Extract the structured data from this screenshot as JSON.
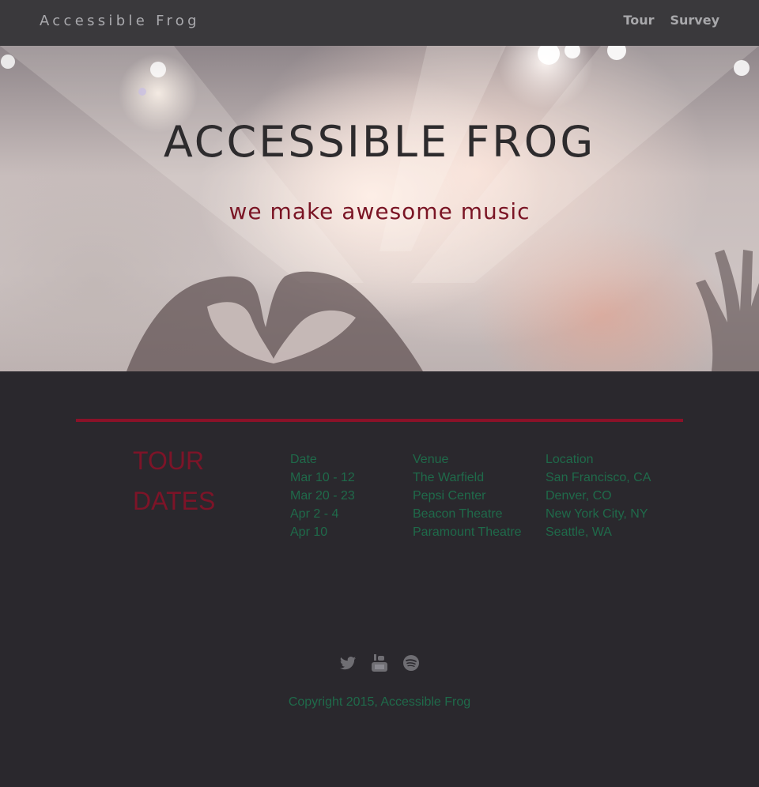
{
  "nav": {
    "brand": "Accessible Frog",
    "links": [
      {
        "label": "Tour"
      },
      {
        "label": "Survey"
      }
    ]
  },
  "hero": {
    "title": "ACCESSIBLE FROG",
    "subtitle": "we make awesome music"
  },
  "tour": {
    "heading_line1": "TOUR",
    "heading_line2": "DATES",
    "columns": [
      "Date",
      "Venue",
      "Location"
    ],
    "rows": [
      [
        "Mar 10 - 12",
        "The Warfield",
        "San Francisco, CA"
      ],
      [
        "Mar 20 - 23",
        "Pepsi Center",
        "Denver, CO"
      ],
      [
        "Apr 2 - 4",
        "Beacon Theatre",
        "New York City, NY"
      ],
      [
        "Apr 10",
        "Paramount Theatre",
        "Seattle, WA"
      ]
    ]
  },
  "social": {
    "icons": [
      "twitter-icon",
      "youtube-icon",
      "spotify-icon"
    ]
  },
  "footer": {
    "copyright": "Copyright 2015, Accessible Frog"
  },
  "colors": {
    "accent": "#8a1228",
    "text_green": "#1f6a4a",
    "background": "#2a282d"
  }
}
